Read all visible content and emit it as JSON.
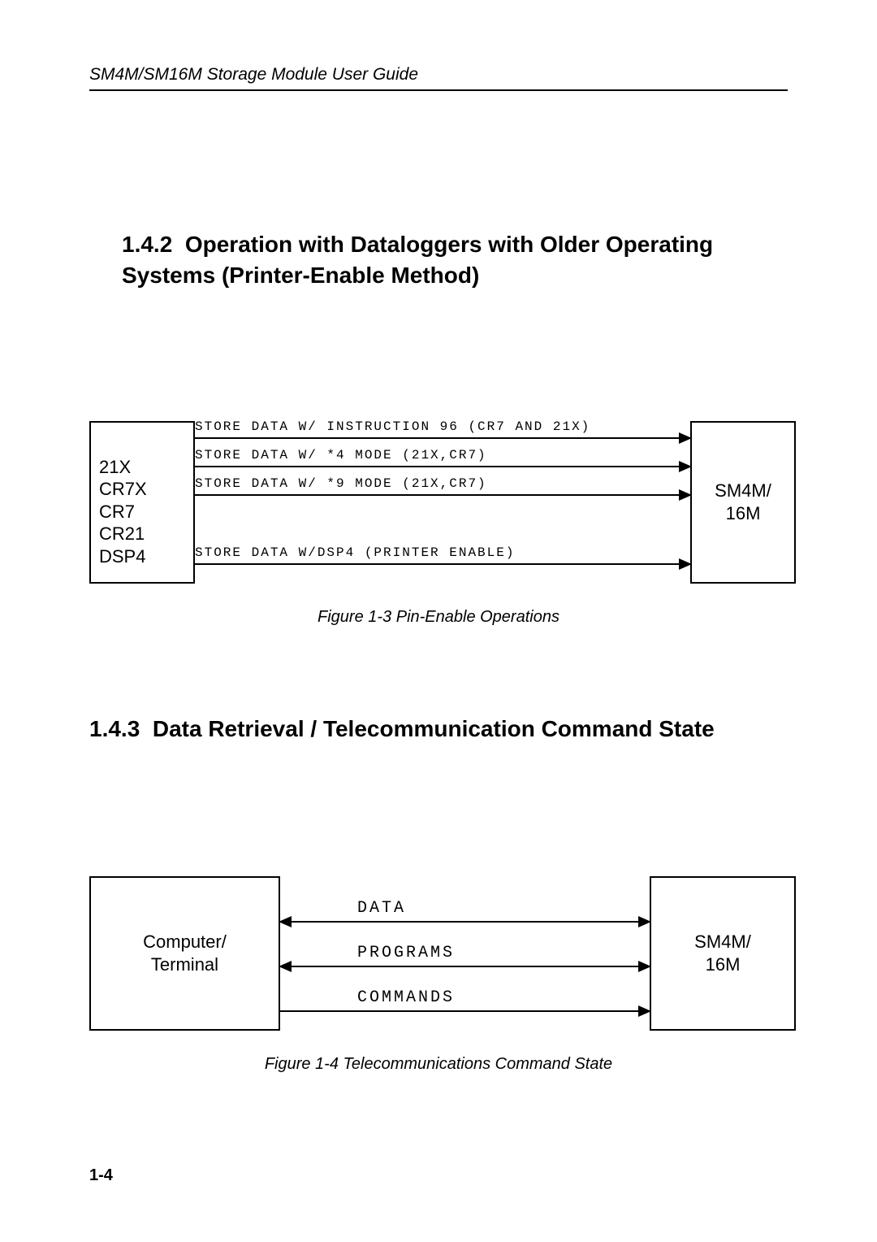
{
  "header": "SM4M/SM16M Storage Module User Guide",
  "sec142": {
    "num": "1.4.2",
    "title": "Operation with Dataloggers with Older Operating Systems (Printer-Enable Method)"
  },
  "fig1": {
    "left": [
      "21X",
      "CR7X",
      "CR7",
      "CR21",
      "DSP4"
    ],
    "right": "SM4M/\n16M",
    "rows": [
      "STORE DATA W/ INSTRUCTION 96 (CR7 AND 21X)",
      "STORE DATA W/ *4 MODE (21X,CR7)",
      "STORE DATA W/ *9 MODE (21X,CR7)",
      "STORE DATA W/DSP4 (PRINTER ENABLE)"
    ],
    "caption": "Figure 1-3  Pin-Enable Operations"
  },
  "sec143": {
    "num": "1.4.3",
    "title": "Data Retrieval / Telecommunication Command State"
  },
  "fig2": {
    "left": "Computer/\nTerminal",
    "right": "SM4M/\n16M",
    "rows": [
      "DATA",
      "PROGRAMS",
      "COMMANDS"
    ],
    "caption": "Figure 1-4  Telecommunications Command State"
  },
  "pagenum": "1-4"
}
